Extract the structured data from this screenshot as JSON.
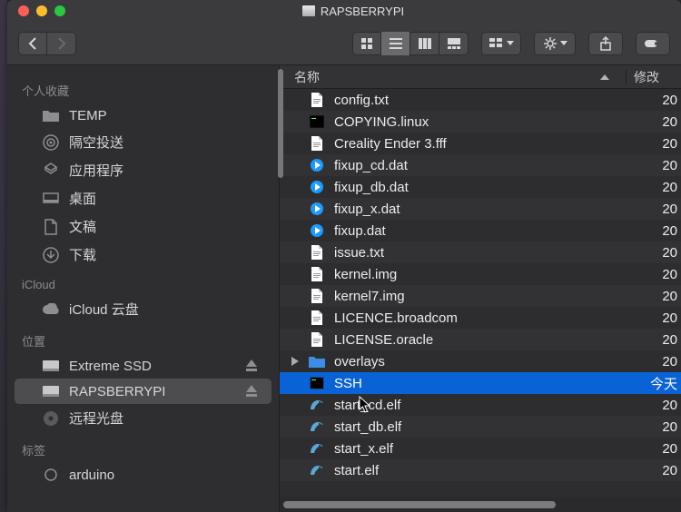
{
  "window_title": "RAPSBERRYPI",
  "sidebar": {
    "sections": [
      {
        "header": "个人收藏",
        "items": [
          {
            "icon": "folder",
            "label": "TEMP"
          },
          {
            "icon": "airdrop",
            "label": "隔空投送"
          },
          {
            "icon": "apps",
            "label": "应用程序"
          },
          {
            "icon": "desktop",
            "label": "桌面"
          },
          {
            "icon": "doc",
            "label": "文稿"
          },
          {
            "icon": "download",
            "label": "下载"
          }
        ]
      },
      {
        "header": "iCloud",
        "items": [
          {
            "icon": "cloud",
            "label": "iCloud 云盘"
          }
        ]
      },
      {
        "header": "位置",
        "items": [
          {
            "icon": "disk",
            "label": "Extreme SSD",
            "eject": true
          },
          {
            "icon": "disk",
            "label": "RAPSBERRYPI",
            "eject": true,
            "selected": true
          },
          {
            "icon": "optical",
            "label": "远程光盘"
          }
        ]
      },
      {
        "header": "标签",
        "items": [
          {
            "icon": "tag",
            "label": "arduino"
          }
        ]
      }
    ]
  },
  "columns": {
    "name": "名称",
    "date": "修改"
  },
  "files": [
    {
      "icon": "txt",
      "name": "config.txt",
      "date": "20"
    },
    {
      "icon": "exec",
      "name": "COPYING.linux",
      "date": "20"
    },
    {
      "icon": "txt",
      "name": "Creality Ender 3.fff",
      "date": "20"
    },
    {
      "icon": "dat",
      "name": "fixup_cd.dat",
      "date": "20"
    },
    {
      "icon": "dat",
      "name": "fixup_db.dat",
      "date": "20"
    },
    {
      "icon": "dat",
      "name": "fixup_x.dat",
      "date": "20"
    },
    {
      "icon": "dat",
      "name": "fixup.dat",
      "date": "20"
    },
    {
      "icon": "txt",
      "name": "issue.txt",
      "date": "20"
    },
    {
      "icon": "txt",
      "name": "kernel.img",
      "date": "20"
    },
    {
      "icon": "txt",
      "name": "kernel7.img",
      "date": "20"
    },
    {
      "icon": "txt",
      "name": "LICENCE.broadcom",
      "date": "20"
    },
    {
      "icon": "txt",
      "name": "LICENSE.oracle",
      "date": "20"
    },
    {
      "icon": "folder",
      "name": "overlays",
      "date": "20",
      "disclosure": true
    },
    {
      "icon": "exec",
      "name": "SSH",
      "date": "今天",
      "selected": true
    },
    {
      "icon": "elf",
      "name": "start_cd.elf",
      "date": "20"
    },
    {
      "icon": "elf",
      "name": "start_db.elf",
      "date": "20"
    },
    {
      "icon": "elf",
      "name": "start_x.elf",
      "date": "20"
    },
    {
      "icon": "elf",
      "name": "start.elf",
      "date": "20"
    }
  ]
}
